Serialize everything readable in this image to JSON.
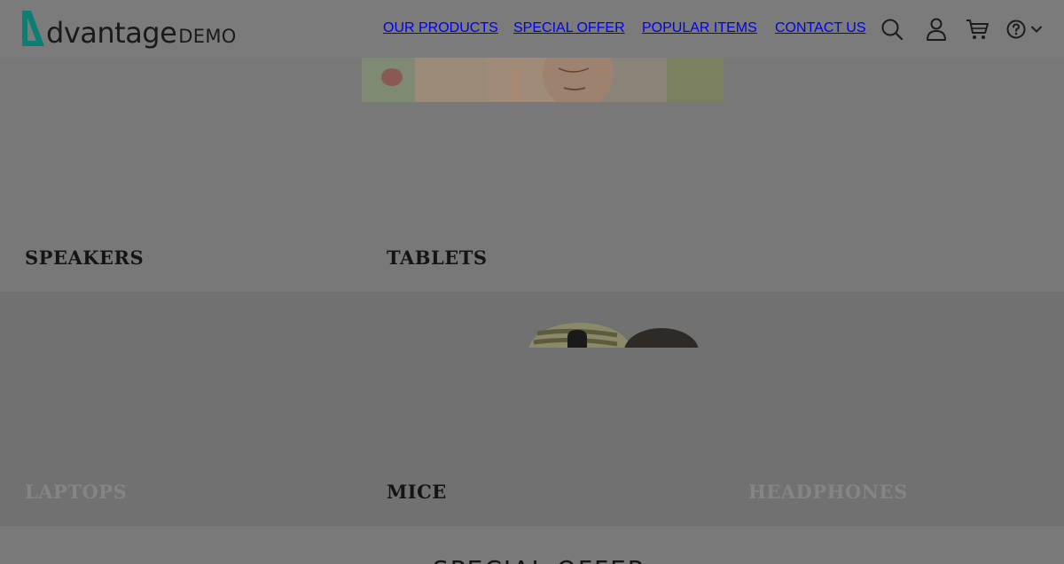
{
  "header": {
    "logo": {
      "word": "dvantage",
      "demo": "DEMO",
      "accent_color": "#0e7d73"
    },
    "nav": [
      {
        "label": "OUR PRODUCTS"
      },
      {
        "label": "SPECIAL OFFER"
      },
      {
        "label": "POPULAR ITEMS"
      },
      {
        "label": "CONTACT US"
      }
    ],
    "icons": [
      "search-icon",
      "user-icon",
      "cart-icon",
      "help-icon",
      "chevron-down-icon"
    ]
  },
  "categories": [
    {
      "label": "SPEAKERS"
    },
    {
      "label": "TABLETS"
    },
    {
      "label": "LAPTOPS"
    },
    {
      "label": "MICE"
    },
    {
      "label": "HEADPHONES"
    }
  ],
  "section": {
    "title": "SPECIAL OFFER"
  },
  "colors": {
    "overlay": "#787878",
    "text": "#141414"
  }
}
